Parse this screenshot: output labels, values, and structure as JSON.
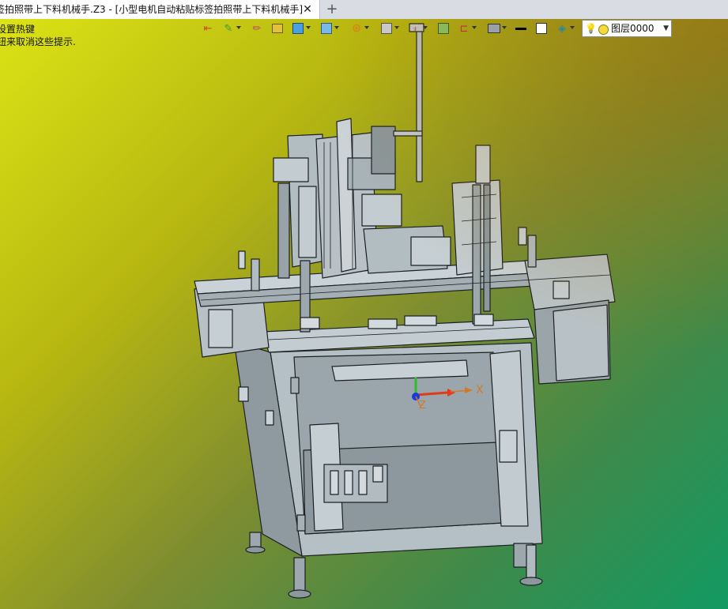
{
  "window": {
    "tab_title": "签拍照带上下料机械手.Z3 - [小型电机自动粘贴标签拍照带上下料机械手]",
    "close_glyph": "✕",
    "new_tab_glyph": "+"
  },
  "hints": {
    "line1": "设置热键",
    "line2": "钮来取消这些提示."
  },
  "toolbar": {
    "icons": [
      "exit-icon",
      "paint-icon",
      "pencil-icon",
      "box-icon",
      "cube-icon",
      "render-icon",
      "wheel-icon",
      "view-icon",
      "probe-icon",
      "image-icon",
      "dimension-icon",
      "monitor-icon",
      "line-weight-icon",
      "frame-icon",
      "layer-stack-icon"
    ]
  },
  "layer_selector": {
    "value": "图层0000",
    "bulb_color": "#c9a400",
    "dot_color": "#f3dc3a"
  },
  "triad": {
    "x_label": "X",
    "z_label": "Z",
    "x_color": "#e03a1a",
    "y_color": "#2dbb2d",
    "z_color": "#1a3ae0"
  },
  "colors": {
    "model_fill": "#a6b2b7",
    "model_line": "#1c2022",
    "bg_top_left": "#dce315",
    "bg_bottom_right": "#129a63"
  }
}
